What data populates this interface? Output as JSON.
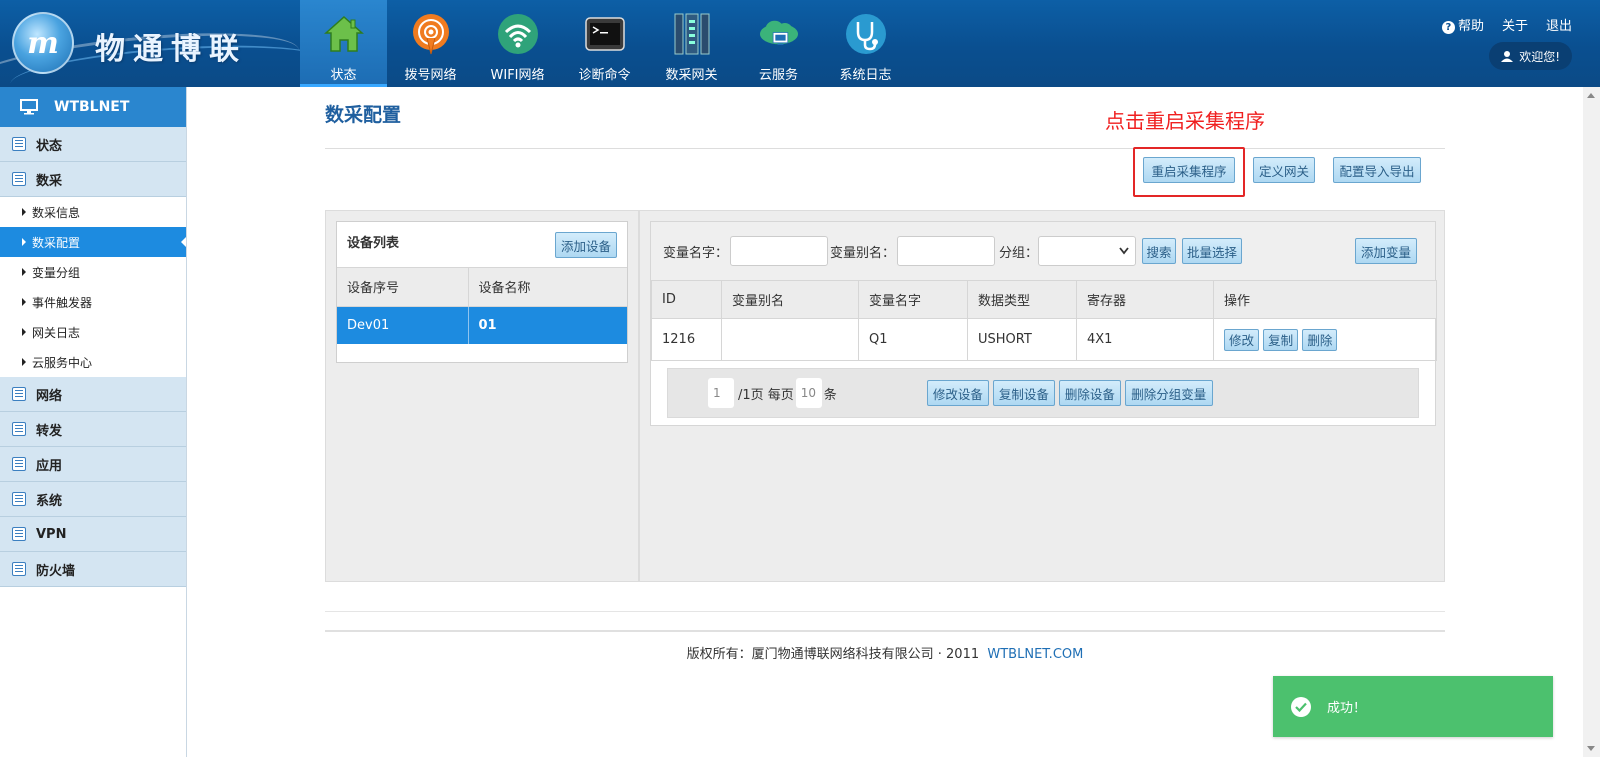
{
  "brand": {
    "logo_letter": "m",
    "name": "物通博联"
  },
  "nav": [
    {
      "label": "状态",
      "icon": "home-icon",
      "active": true
    },
    {
      "label": "拨号网络",
      "icon": "dial-network-icon",
      "active": false
    },
    {
      "label": "WIFI网络",
      "icon": "wifi-icon",
      "active": false
    },
    {
      "label": "诊断命令",
      "icon": "terminal-icon",
      "active": false
    },
    {
      "label": "数采网关",
      "icon": "gateway-icon",
      "active": false
    },
    {
      "label": "云服务",
      "icon": "cloud-icon",
      "active": false
    },
    {
      "label": "系统日志",
      "icon": "stethoscope-icon",
      "active": false
    }
  ],
  "top_links": {
    "help": "帮助",
    "about": "关于",
    "logout": "退出",
    "welcome": "欢迎您!"
  },
  "sidebar": {
    "title": "WTBLNET",
    "groups": [
      {
        "label": "状态"
      },
      {
        "label": "数采",
        "children": [
          "数采信息",
          "数采配置",
          "变量分组",
          "事件触发器",
          "网关日志",
          "云服务中心"
        ],
        "active_child": "数采配置"
      },
      {
        "label": "网络"
      },
      {
        "label": "转发"
      },
      {
        "label": "应用"
      },
      {
        "label": "系统"
      },
      {
        "label": "VPN"
      },
      {
        "label": "防火墙"
      }
    ]
  },
  "main": {
    "title": "数采配置",
    "annotation": "点击重启采集程序",
    "actions": {
      "restart": "重启采集程序",
      "define_gateway": "定义网关",
      "import_export": "配置导入导出"
    }
  },
  "device_list": {
    "title": "设备列表",
    "add_button": "添加设备",
    "columns": [
      "设备序号",
      "设备名称"
    ],
    "rows": [
      [
        "Dev01",
        "01"
      ]
    ]
  },
  "filter": {
    "var_name_label": "变量名字：",
    "var_alias_label": "变量别名：",
    "group_label": "分组：",
    "search": "搜索",
    "batch_select": "批量选择",
    "add_variable": "添加变量"
  },
  "variables": {
    "columns": [
      "ID",
      "变量别名",
      "变量名字",
      "数据类型",
      "寄存器",
      "操作"
    ],
    "rows": [
      {
        "id": "1216",
        "alias": "",
        "name": "Q1",
        "type": "USHORT",
        "register": "4X1"
      }
    ],
    "row_actions": {
      "edit": "修改",
      "copy": "复制",
      "delete": "删除"
    }
  },
  "pager": {
    "page": "1",
    "total_pages_text": "/1页 每页",
    "per_page": "10",
    "unit": "条",
    "edit_device": "修改设备",
    "copy_device": "复制设备",
    "delete_device": "删除设备",
    "delete_group_vars": "删除分组变量"
  },
  "footer": {
    "text": "版权所有：厦门物通博联网络科技有限公司 · 2011",
    "link": "WTBLNET.COM"
  },
  "toast": {
    "message": "成功！"
  },
  "colors": {
    "header": "#0b4f90",
    "accent": "#1d8be0",
    "annotation": "#f02020",
    "toast": "#4cc16e"
  }
}
